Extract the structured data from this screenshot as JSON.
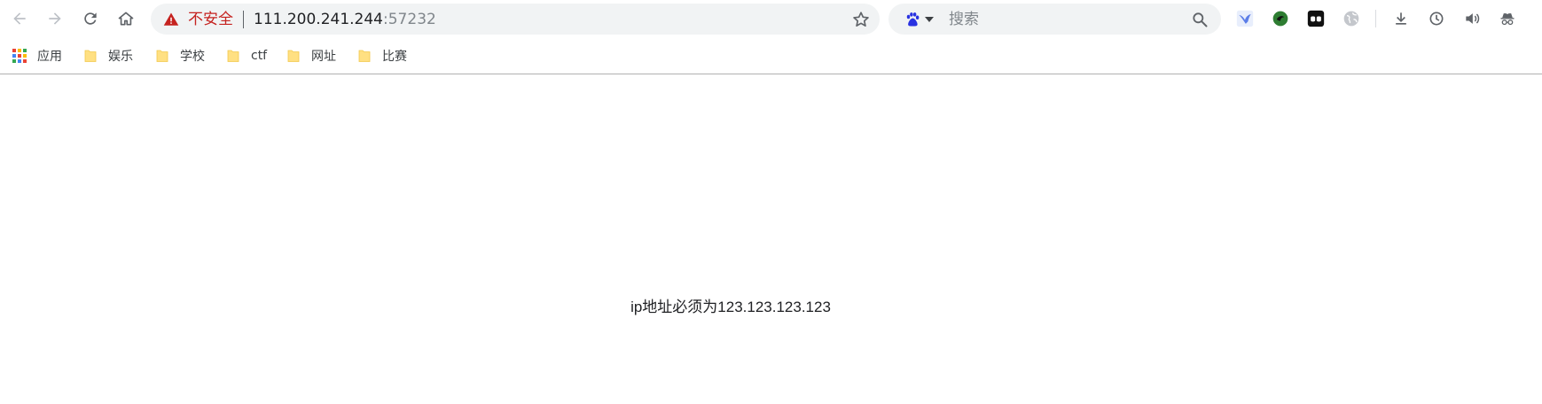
{
  "toolbar": {
    "back_icon": "arrow-left-icon",
    "forward_icon": "arrow-right-icon",
    "reload_icon": "reload-icon",
    "home_icon": "home-icon"
  },
  "omnibox": {
    "security_label": "不安全",
    "host": "111.200.241.244",
    "port": ":57232",
    "warning_icon": "warning-triangle-icon",
    "bookmark_icon": "star-icon"
  },
  "search": {
    "engine_icon": "baidu-paw-icon",
    "placeholder": "搜索",
    "search_icon": "search-icon"
  },
  "extensions": [
    {
      "icon": "bird-icon"
    },
    {
      "icon": "green-circle-extension-icon"
    },
    {
      "icon": "black-extension-icon"
    },
    {
      "icon": "globe-icon"
    },
    {
      "icon": "download-icon"
    },
    {
      "icon": "history-clock-icon"
    },
    {
      "icon": "speaker-icon"
    },
    {
      "icon": "incognito-icon"
    }
  ],
  "bookmarks": {
    "apps_label": "应用",
    "items": [
      {
        "label": "娱乐"
      },
      {
        "label": "学校"
      },
      {
        "label": "ctf"
      },
      {
        "label": "网址"
      },
      {
        "label": "比赛"
      }
    ]
  },
  "page": {
    "message": "ip地址必须为123.123.123.123"
  },
  "colors": {
    "insecure": "#c5221f",
    "folder": "#ffe082",
    "omnibox_bg": "#f1f3f4"
  }
}
